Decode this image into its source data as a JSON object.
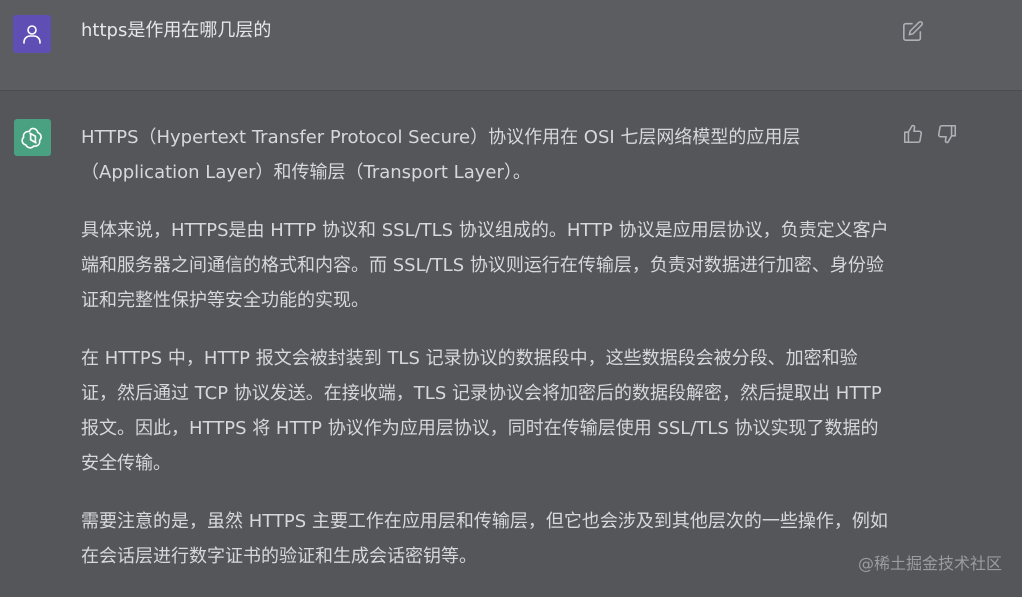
{
  "user_message": {
    "text": "https是作用在哪几层的",
    "avatar_icon": "user-icon",
    "edit_icon": "edit-icon",
    "avatar_color": "#5f4eb3"
  },
  "assistant_message": {
    "avatar_icon": "openai-logo-icon",
    "avatar_color": "#4aa181",
    "paragraphs": [
      "HTTPS（Hypertext Transfer Protocol Secure）协议作用在 OSI 七层网络模型的应用层（Application Layer）和传输层（Transport Layer）。",
      "具体来说，HTTPS是由 HTTP 协议和 SSL/TLS 协议组成的。HTTP 协议是应用层协议，负责定义客户端和服务器之间通信的格式和内容。而 SSL/TLS 协议则运行在传输层，负责对数据进行加密、身份验证和完整性保护等安全功能的实现。",
      "在 HTTPS 中，HTTP 报文会被封装到 TLS 记录协议的数据段中，这些数据段会被分段、加密和验证，然后通过 TCP 协议发送。在接收端，TLS 记录协议会将加密后的数据段解密，然后提取出 HTTP 报文。因此，HTTPS 将 HTTP 协议作为应用层协议，同时在传输层使用 SSL/TLS 协议实现了数据的安全传输。",
      "需要注意的是，虽然 HTTPS 主要工作在应用层和传输层，但它也会涉及到其他层次的一些操作，例如在会话层进行数字证书的验证和生成会话密钥等。"
    ],
    "feedback_icons": [
      "thumbs-up-icon",
      "thumbs-down-icon"
    ]
  },
  "watermark": "@稀土掘金技术社区"
}
